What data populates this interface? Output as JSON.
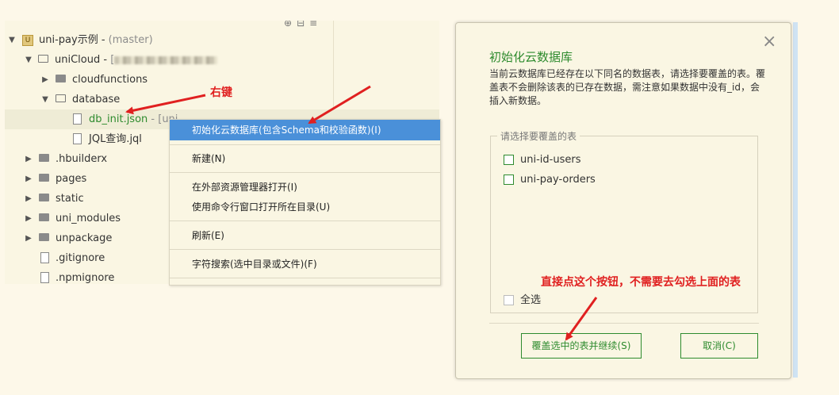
{
  "explorer": {
    "tree": [
      {
        "label": "uni-pay示例",
        "suffix": "(master)"
      },
      {
        "label": "uniCloud",
        "suffix": "["
      },
      {
        "label": "cloudfunctions"
      },
      {
        "label": "database"
      },
      {
        "label": "db_init.json",
        "suffix": "[uni"
      },
      {
        "label": "JQL查询.jql"
      },
      {
        "label": ".hbuilderx"
      },
      {
        "label": "pages"
      },
      {
        "label": "static"
      },
      {
        "label": "uni_modules"
      },
      {
        "label": "unpackage"
      },
      {
        "label": ".gitignore"
      },
      {
        "label": ".npmignore"
      }
    ]
  },
  "context_menu": {
    "items": [
      {
        "label": "初始化云数据库(包含Schema和校验函数)(I)"
      },
      {
        "label": "新建(N)"
      },
      {
        "label": "在外部资源管理器打开(I)"
      },
      {
        "label": "使用命令行窗口打开所在目录(U)"
      },
      {
        "label": "刷新(E)"
      },
      {
        "label": "字符搜索(选中目录或文件)(F)"
      }
    ]
  },
  "dialog": {
    "close_glyph": "×",
    "title": "初始化云数据库",
    "description": "当前云数据库已经存在以下同名的数据表，请选择要覆盖的表。覆盖表不会删除该表的已存在数据，需注意如果数据中没有_id，会插入新数据。",
    "group_legend": "请选择要覆盖的表",
    "tables": [
      {
        "label": "uni-id-users"
      },
      {
        "label": "uni-pay-orders"
      }
    ],
    "select_all": "全选",
    "confirm_button": "覆盖选中的表并继续(S)",
    "cancel_button": "取消(C)"
  },
  "annotations": {
    "right_click": "右键",
    "button_hint": "直接点这个按钮，不需要去勾选上面的表"
  },
  "colors": {
    "accent": "#2e8b2e",
    "highlight": "#4a90d9",
    "annotation": "#e02020",
    "background": "#fdf8e9"
  }
}
